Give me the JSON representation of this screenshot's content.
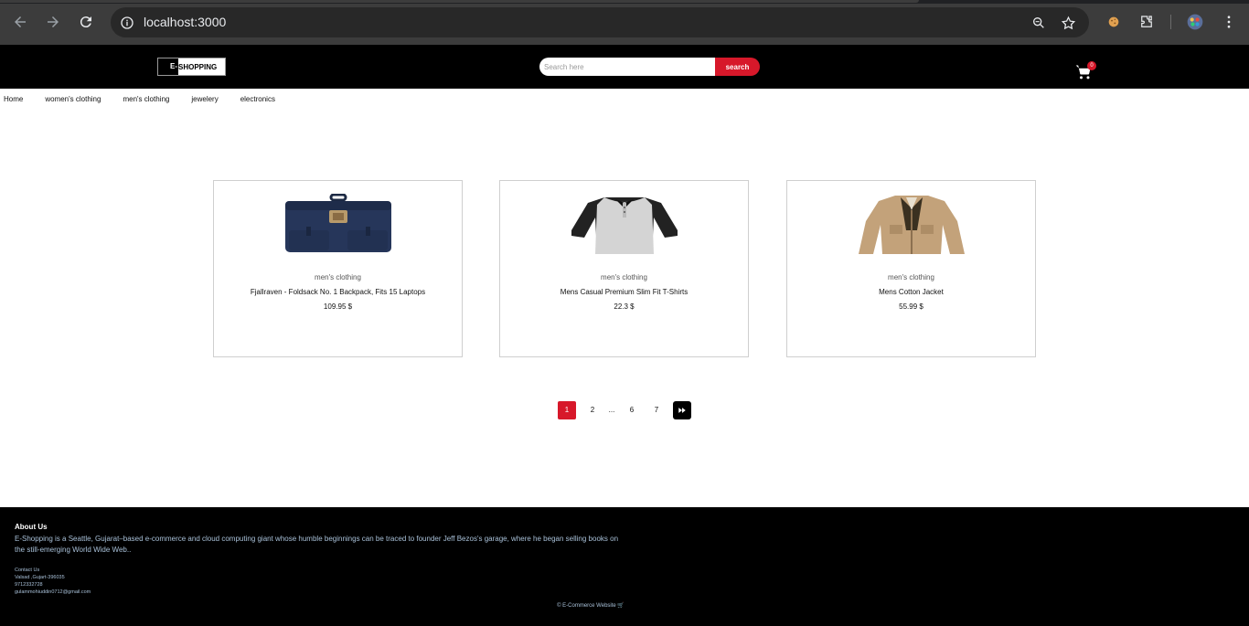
{
  "browser": {
    "url": "localhost:3000"
  },
  "header": {
    "logo_e": "E-",
    "logo_rest": "SHOPPING",
    "search_placeholder": "Search here",
    "search_button": "search",
    "cart_count": "0"
  },
  "nav": {
    "items": [
      "Home",
      "women's clothing",
      "men's clothing",
      "jewelery",
      "electronics"
    ]
  },
  "products": [
    {
      "category": "men's clothing",
      "title": "Fjallraven - Foldsack No. 1 Backpack, Fits 15 Laptops",
      "price": "109.95 $",
      "image": "backpack-image"
    },
    {
      "category": "men's clothing",
      "title": "Mens Casual Premium Slim Fit T-Shirts",
      "price": "22.3 $",
      "image": "tshirt-image"
    },
    {
      "category": "men's clothing",
      "title": "Mens Cotton Jacket",
      "price": "55.99 $",
      "image": "jacket-image"
    }
  ],
  "pagination": {
    "pages": [
      "1",
      "2",
      "...",
      "6",
      "7"
    ],
    "active": "1",
    "next_icon": "fast-forward-icon"
  },
  "footer": {
    "about_heading": "About Us",
    "about_text": "E-Shopping is a Seattle, Gujarat–based e-commerce and cloud computing giant whose humble beginnings can be traced to founder Jeff Bezos's garage, where he began selling books on the still-emerging World Wide Web..",
    "contact_heading": "Contact Us",
    "address": "Valsad ,Gujart-396035",
    "phone": "9712332728",
    "email": "gulammohiuddin0712@gmail.com",
    "copyright": "© E-Commerce Website 🛒"
  },
  "colors": {
    "accent": "#d7182a",
    "header_bg": "#000000",
    "footer_text": "#a8c0d8"
  }
}
